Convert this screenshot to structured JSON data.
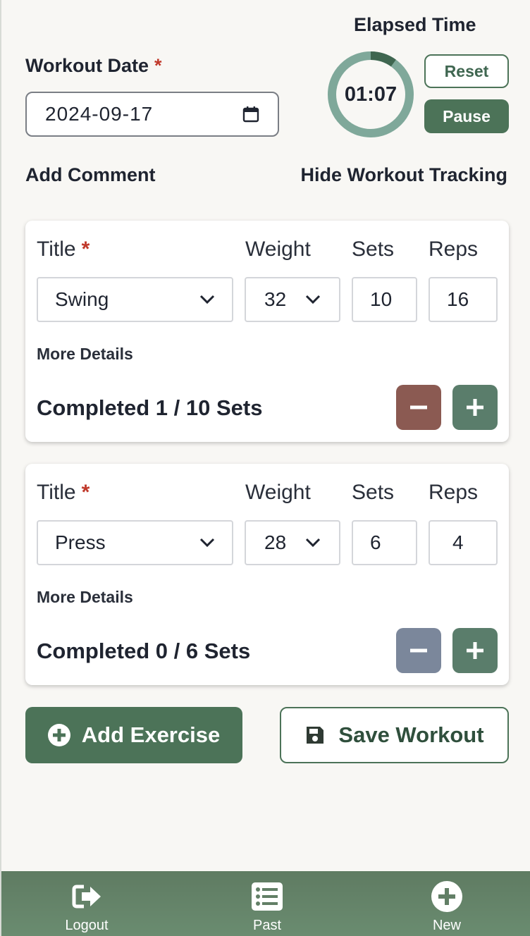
{
  "workout_date": {
    "label": "Workout Date",
    "required_mark": "*",
    "value": "2024-09-17"
  },
  "timer": {
    "label": "Elapsed Time",
    "display": "01:07",
    "progress_fraction": 0.1,
    "reset_label": "Reset",
    "pause_label": "Pause"
  },
  "links": {
    "add_comment": "Add Comment",
    "hide_tracking": "Hide Workout Tracking"
  },
  "exercises": [
    {
      "title_label": "Title",
      "required_mark": "*",
      "weight_label": "Weight",
      "sets_label": "Sets",
      "reps_label": "Reps",
      "title": "Swing",
      "weight": "32",
      "sets": "10",
      "reps": "16",
      "more_details": "More Details",
      "completed_text": "Completed 1 / 10 Sets",
      "minus_color": "#8b5a52"
    },
    {
      "title_label": "Title",
      "required_mark": "*",
      "weight_label": "Weight",
      "sets_label": "Sets",
      "reps_label": "Reps",
      "title": "Press",
      "weight": "28",
      "sets": "6",
      "reps": "4",
      "more_details": "More Details",
      "completed_text": "Completed 0 / 6 Sets",
      "minus_color": "#7b879b"
    }
  ],
  "actions": {
    "add_exercise": "Add Exercise",
    "save_workout": "Save Workout"
  },
  "nav": {
    "logout": "Logout",
    "past": "Past",
    "new": "New"
  },
  "colors": {
    "primary": "#4c7358",
    "timer_track": "#7fa89a",
    "timer_progress": "#3f6650",
    "plus_button": "#5a7d6b",
    "required": "#c0392b"
  }
}
